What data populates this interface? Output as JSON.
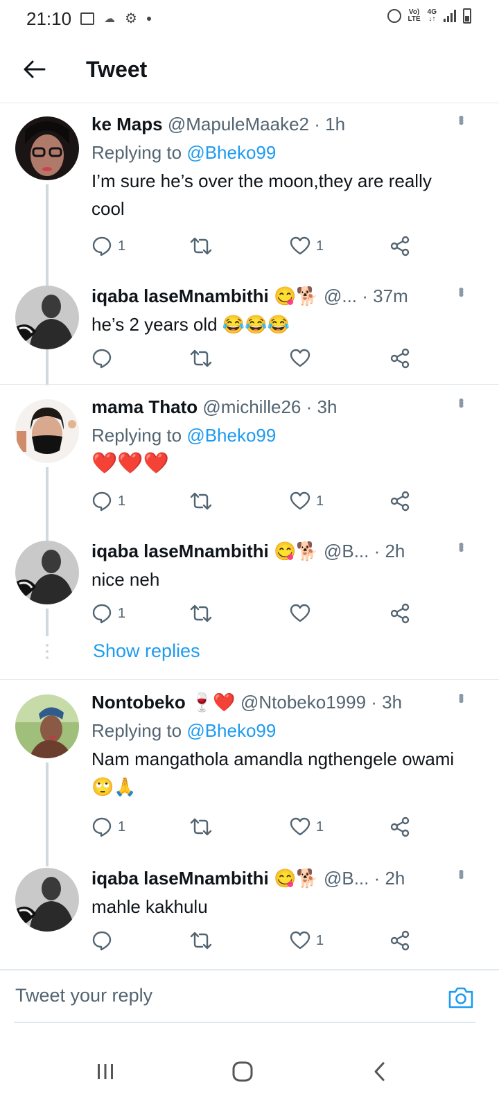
{
  "status_bar": {
    "time": "21:10",
    "lte_top": "Vo)",
    "lte_bottom": "LTE",
    "net_top": "4G",
    "net_bottom": "↓↑"
  },
  "header": {
    "title": "Tweet"
  },
  "tweets": [
    {
      "name": "ke Maps",
      "handle": "@MapuleMaake2",
      "time": "· 1h",
      "replying_prefix": "Replying to",
      "replying_to": "@Bheko99",
      "text": "I’m sure he’s over the moon,they are really cool",
      "reply_count": "1",
      "like_count": "1"
    },
    {
      "name": "iqaba laseMnambithi",
      "name_emojis": "😋🐕",
      "handle": "@...",
      "time": "· 37m",
      "text": "he’s 2 years old 😂😂😂",
      "reply_count": "",
      "like_count": ""
    },
    {
      "name": "mama Thato",
      "handle": "@michille26",
      "time": "· 3h",
      "replying_prefix": "Replying to",
      "replying_to": "@Bheko99",
      "text": "❤️❤️❤️",
      "reply_count": "1",
      "like_count": "1"
    },
    {
      "name": "iqaba laseMnambithi",
      "name_emojis": "😋🐕",
      "handle": "@B...",
      "time": "· 2h",
      "text": "nice neh",
      "reply_count": "1",
      "like_count": ""
    },
    {
      "name": "Nontobeko",
      "name_emojis": "🍷❤️",
      "handle": "@Ntobeko1999",
      "time": "· 3h",
      "replying_prefix": "Replying to",
      "replying_to": "@Bheko99",
      "text": "Nam mangathola amandla ngthengele owami🙄🙏",
      "reply_count": "1",
      "like_count": "1"
    },
    {
      "name": "iqaba laseMnambithi",
      "name_emojis": "😋🐕",
      "handle": "@B...",
      "time": "· 2h",
      "text": "mahle kakhulu",
      "reply_count": "",
      "like_count": "1"
    }
  ],
  "show_replies": "Show replies",
  "reply_bar": {
    "placeholder": "Tweet your reply"
  },
  "colors": {
    "accent": "#1d9bf0",
    "text": "#0f1419",
    "muted": "#536471",
    "divider": "#e1e8ed"
  }
}
